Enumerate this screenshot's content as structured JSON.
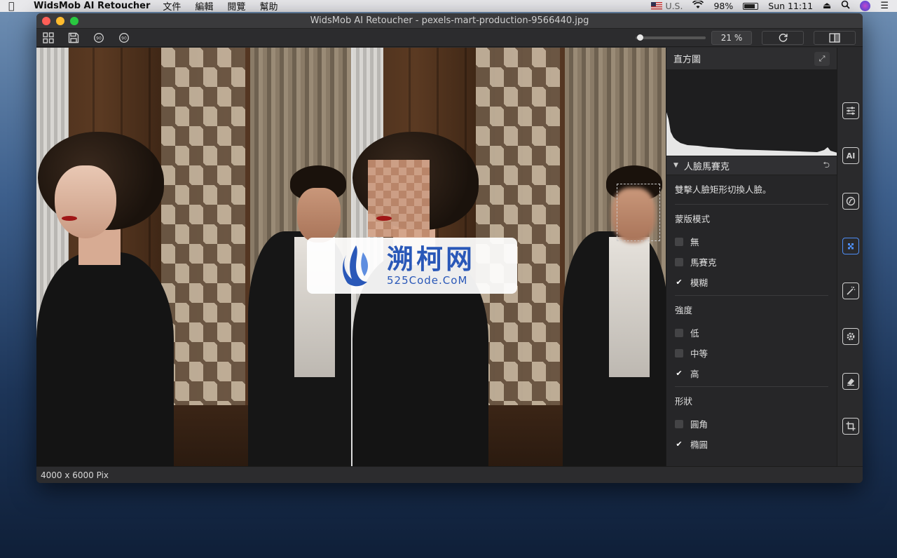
{
  "menubar": {
    "app_name": "WidsMob AI Retoucher",
    "menus": [
      "文件",
      "編輯",
      "閱覽",
      "幫助"
    ],
    "input_source": "U.S.",
    "battery": "98%",
    "clock": "Sun 11:11"
  },
  "window": {
    "title": "WidsMob AI Retoucher - pexels-mart-production-9566440.jpg"
  },
  "toolbar": {
    "zoom": "21 %",
    "zoom_level": 0.21
  },
  "watermark": {
    "cn": "溯柯网",
    "en": "525Code.CoM"
  },
  "panel": {
    "histogram_title": "直方圖",
    "section_title": "人臉馬賽克",
    "description": "雙擊人臉矩形切換人臉。",
    "mask_mode": {
      "title": "蒙版模式",
      "options": [
        {
          "label": "無",
          "checked": false
        },
        {
          "label": "馬賽克",
          "checked": false
        },
        {
          "label": "模糊",
          "checked": true
        }
      ]
    },
    "intensity": {
      "title": "強度",
      "options": [
        {
          "label": "低",
          "checked": false
        },
        {
          "label": "中等",
          "checked": false
        },
        {
          "label": "高",
          "checked": true
        }
      ]
    },
    "shape": {
      "title": "形狀",
      "options": [
        {
          "label": "圓角",
          "checked": false
        },
        {
          "label": "橢圓",
          "checked": true
        }
      ]
    }
  },
  "rail": {
    "ai_label": "AI"
  },
  "status": {
    "dimensions": "4000 x 6000 Pix"
  },
  "colors": {
    "accent": "#4d8df5",
    "close": "#fe5f57",
    "minimize": "#febb2e",
    "maximize": "#29c840"
  }
}
